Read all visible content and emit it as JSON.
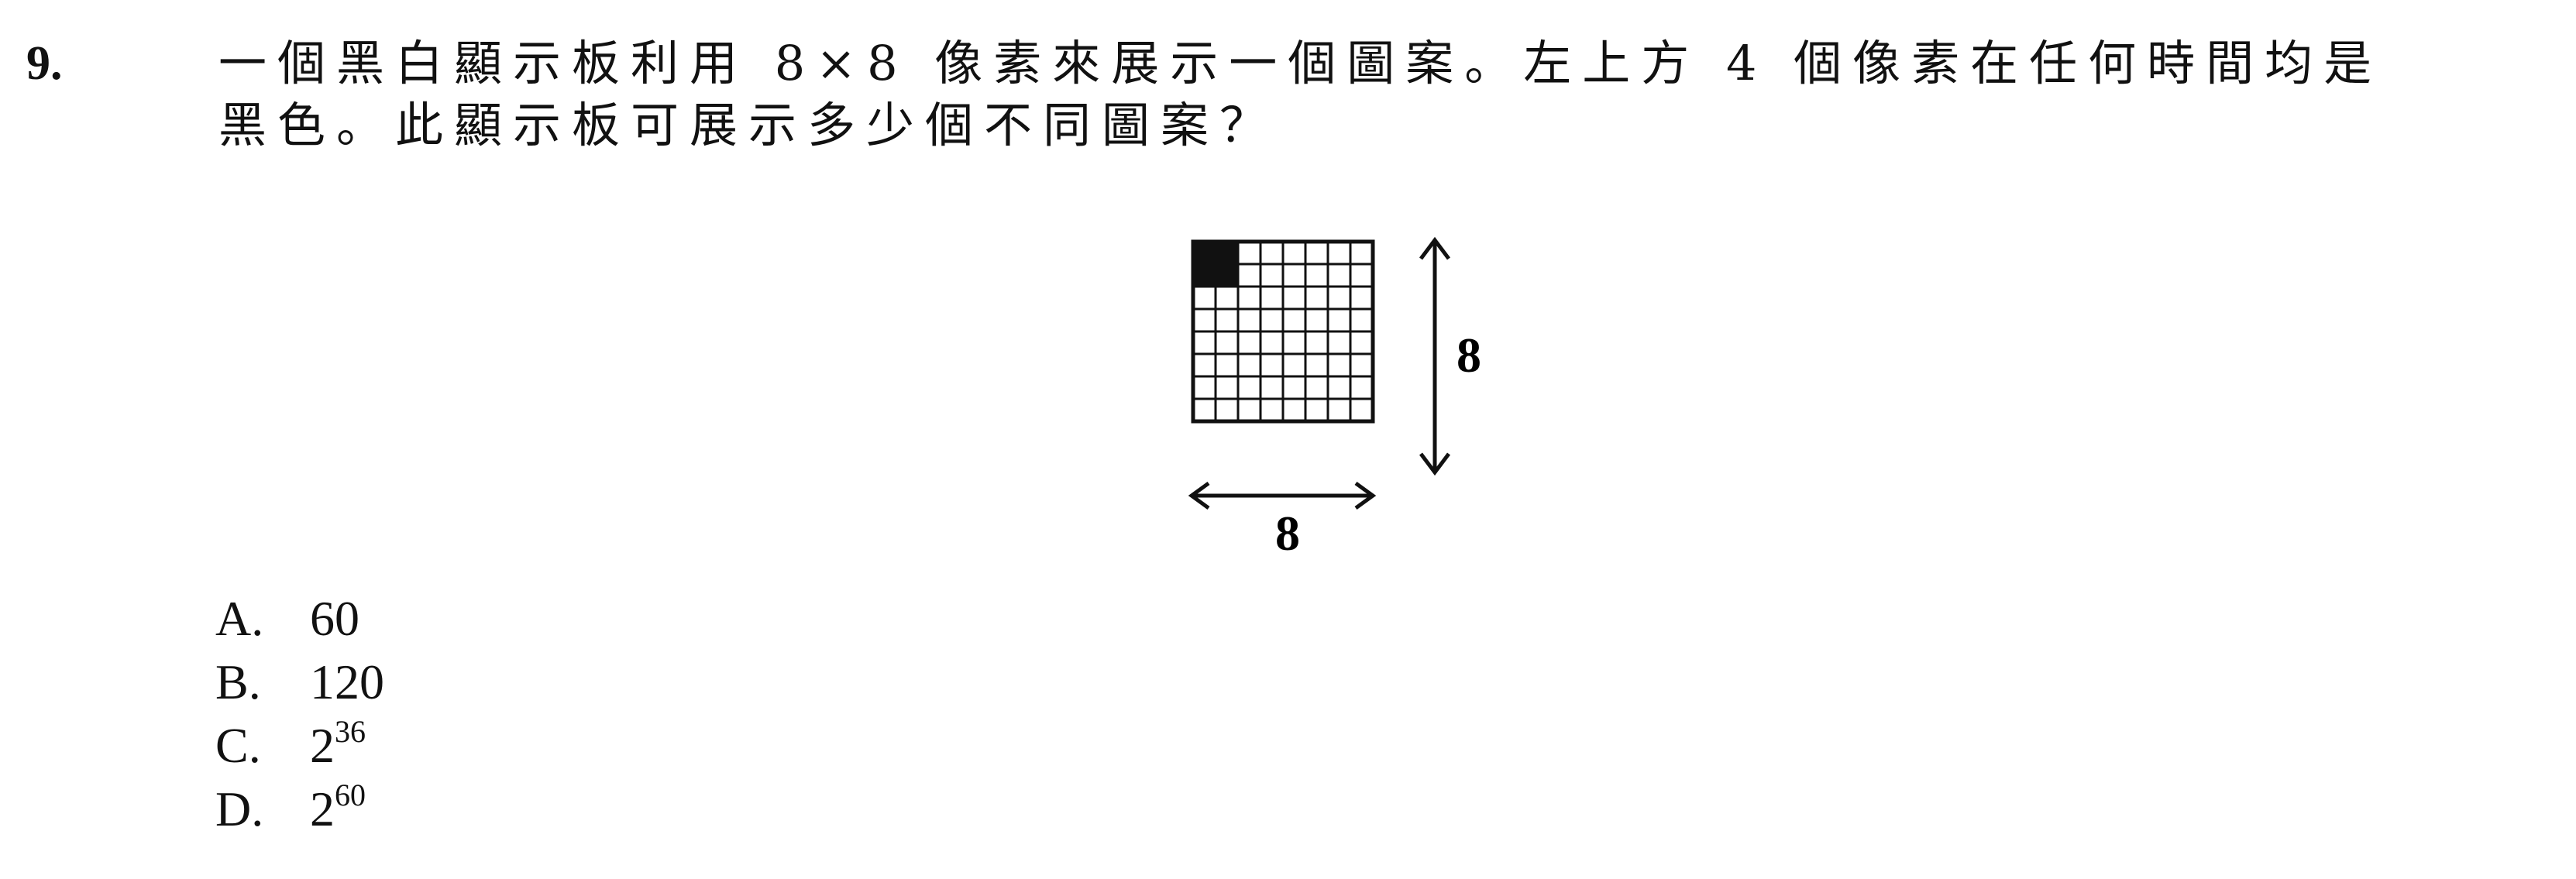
{
  "question": {
    "number": "9.",
    "line1": "一個黑白顯示板利用 8×8 像素來展示一個圖案。左上方 4 個像素在任何時間均是",
    "line2": "黑色。此顯示板可展示多少個不同圖案？"
  },
  "figure": {
    "grid_rows": 8,
    "grid_cols": 8,
    "black_cells": [
      [
        0,
        0
      ],
      [
        0,
        1
      ],
      [
        1,
        0
      ],
      [
        1,
        1
      ]
    ],
    "height_label": "8",
    "width_label": "8"
  },
  "options": [
    {
      "letter": "A.",
      "base": "60",
      "exp": ""
    },
    {
      "letter": "B.",
      "base": "120",
      "exp": ""
    },
    {
      "letter": "C.",
      "base": "2",
      "exp": "36"
    },
    {
      "letter": "D.",
      "base": "2",
      "exp": "60"
    }
  ]
}
